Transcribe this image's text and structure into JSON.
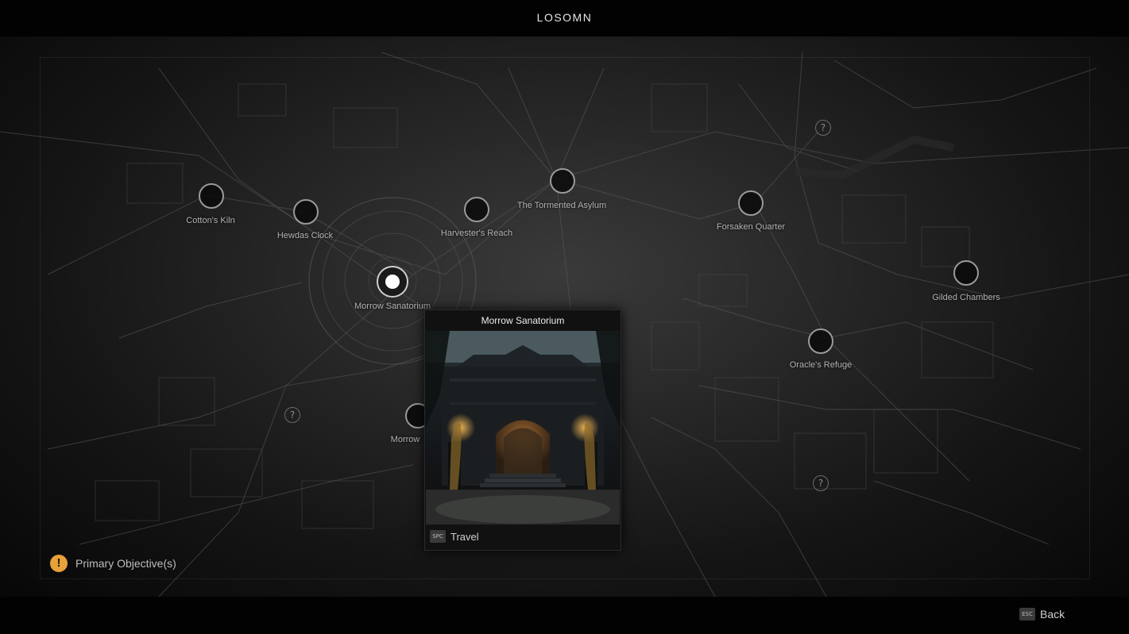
{
  "header": {
    "title": "LOSOMN"
  },
  "map": {
    "locations": [
      {
        "name": "Cotton's Kiln",
        "state": "inactive"
      },
      {
        "name": "Hewdas Clock",
        "state": "inactive"
      },
      {
        "name": "Harvester's Reach",
        "state": "inactive"
      },
      {
        "name": "The Tormented Asylum",
        "state": "inactive"
      },
      {
        "name": "Forsaken Quarter",
        "state": "inactive"
      },
      {
        "name": "Gilded Chambers",
        "state": "inactive"
      },
      {
        "name": "Morrow Sanatorium",
        "state": "selected"
      },
      {
        "name": "Oracle's Refuge",
        "state": "inactive"
      },
      {
        "name": "Morrow",
        "state": "partially-hidden"
      }
    ],
    "unknown_marker_glyph": "?"
  },
  "popup": {
    "title": "Morrow Sanatorium",
    "action_key": "SPC",
    "action_label": "Travel"
  },
  "objective": {
    "icon": "exclamation-icon",
    "icon_glyph": "!",
    "label": "Primary Objective(s)",
    "color": "#e8a23a"
  },
  "footer": {
    "back_key": "ESC",
    "back_label": "Back"
  }
}
